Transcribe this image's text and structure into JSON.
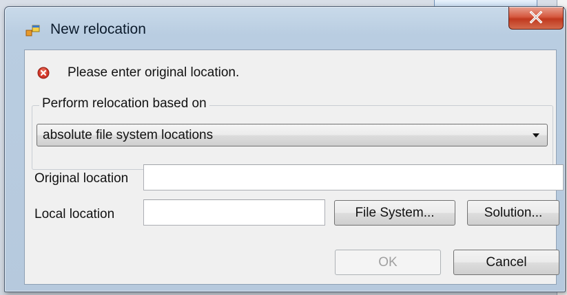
{
  "dialog": {
    "title": "New relocation",
    "close_glyph": "X"
  },
  "validation": {
    "icon": "error-icon",
    "message": "Please enter original location."
  },
  "relocation_group": {
    "label": "Perform relocation based on",
    "selected_option": "absolute file system locations"
  },
  "fields": {
    "original_location": {
      "label": "Original location",
      "value": ""
    },
    "local_location": {
      "label": "Local location",
      "value": ""
    }
  },
  "buttons": {
    "file_system": "File System...",
    "solution": "Solution...",
    "ok": "OK",
    "cancel": "Cancel"
  },
  "colors": {
    "error_red": "#d2382b",
    "close_red": "#c0391f"
  }
}
